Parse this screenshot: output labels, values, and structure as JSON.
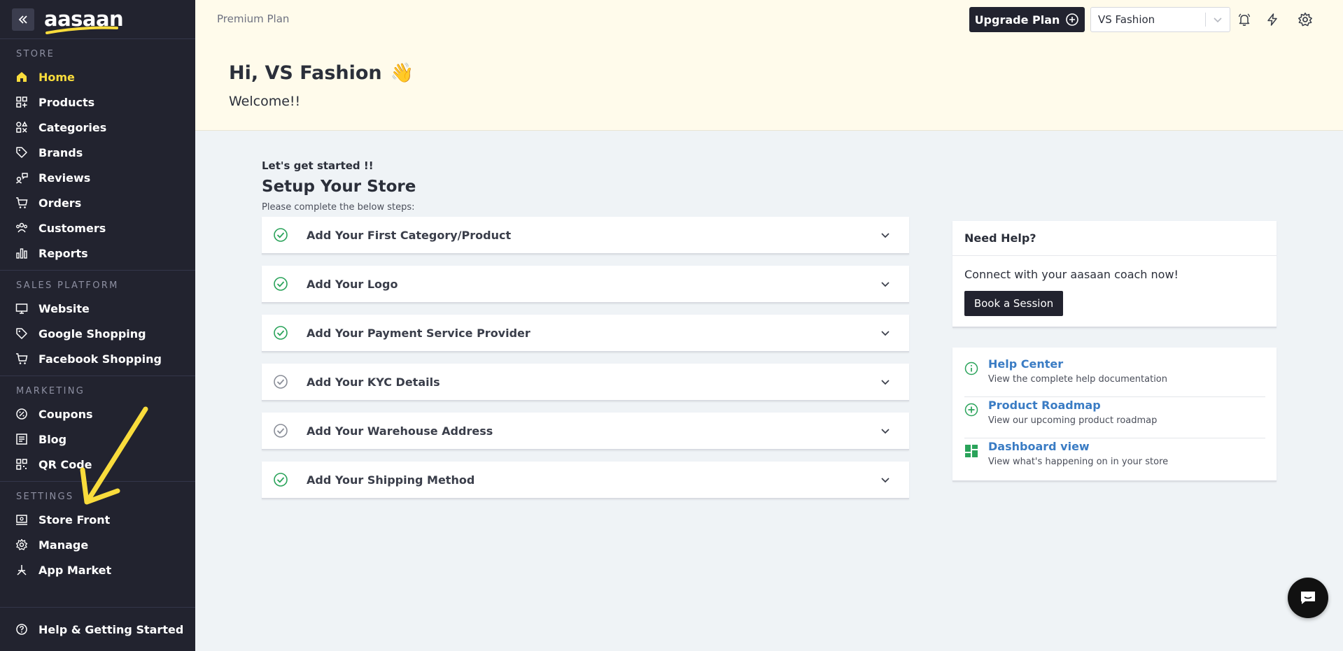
{
  "app": {
    "logo_text": "aasaan",
    "brand_yellow": "#f9dc3c",
    "sidebar_bg": "#22232f",
    "link_blue": "#3a7cc4",
    "check_green": "#2aa35a"
  },
  "sidebar": {
    "sections": [
      {
        "title": "STORE",
        "items": [
          {
            "label": "Home",
            "icon": "home-icon",
            "active": true
          },
          {
            "label": "Products",
            "icon": "products-icon"
          },
          {
            "label": "Categories",
            "icon": "categories-icon"
          },
          {
            "label": "Brands",
            "icon": "tag-icon"
          },
          {
            "label": "Reviews",
            "icon": "reviews-icon"
          },
          {
            "label": "Orders",
            "icon": "cart-icon"
          },
          {
            "label": "Customers",
            "icon": "users-icon"
          },
          {
            "label": "Reports",
            "icon": "bar-chart-icon"
          }
        ]
      },
      {
        "title": "SALES PLATFORM",
        "items": [
          {
            "label": "Website",
            "icon": "monitor-icon"
          },
          {
            "label": "Google Shopping",
            "icon": "tag-icon"
          },
          {
            "label": "Facebook Shopping",
            "icon": "cart-icon"
          }
        ]
      },
      {
        "title": "MARKETING",
        "items": [
          {
            "label": "Coupons",
            "icon": "coupon-icon"
          },
          {
            "label": "Blog",
            "icon": "blog-icon"
          },
          {
            "label": "QR Code",
            "icon": "qr-code-icon"
          }
        ]
      },
      {
        "title": "SETTINGS",
        "items": [
          {
            "label": "Store Front",
            "icon": "storefront-icon"
          },
          {
            "label": "Manage",
            "icon": "gear-icon"
          },
          {
            "label": "App Market",
            "icon": "app-market-icon"
          }
        ]
      }
    ],
    "bottom": {
      "label": "Help & Getting Started",
      "icon": "help-circle-icon"
    }
  },
  "header": {
    "plan": "Premium Plan",
    "upgrade_label": "Upgrade Plan",
    "store_selected": "VS Fashion",
    "greeting": "Hi, VS Fashion",
    "greeting_emoji": "👋",
    "welcome": "Welcome!!"
  },
  "setup": {
    "kicker": "Let's get started !!",
    "title": "Setup Your Store",
    "subtitle": "Please complete the below steps:",
    "steps": [
      {
        "label": "Add Your First Category/Product",
        "done": true
      },
      {
        "label": "Add Your Logo",
        "done": true
      },
      {
        "label": "Add Your Payment Service Provider",
        "done": true
      },
      {
        "label": "Add Your KYC Details",
        "done": false
      },
      {
        "label": "Add Your Warehouse Address",
        "done": false
      },
      {
        "label": "Add Your Shipping Method",
        "done": true
      }
    ]
  },
  "help": {
    "title": "Need Help?",
    "text": "Connect with your aasaan coach now!",
    "button": "Book a Session"
  },
  "links": [
    {
      "title": "Help Center",
      "desc": "View the complete help documentation",
      "icon": "info-icon"
    },
    {
      "title": "Product Roadmap",
      "desc": "View our upcoming product roadmap",
      "icon": "plus-circle-icon"
    },
    {
      "title": "Dashboard view",
      "desc": "View what's happening on in your store",
      "icon": "dashboard-icon"
    }
  ]
}
